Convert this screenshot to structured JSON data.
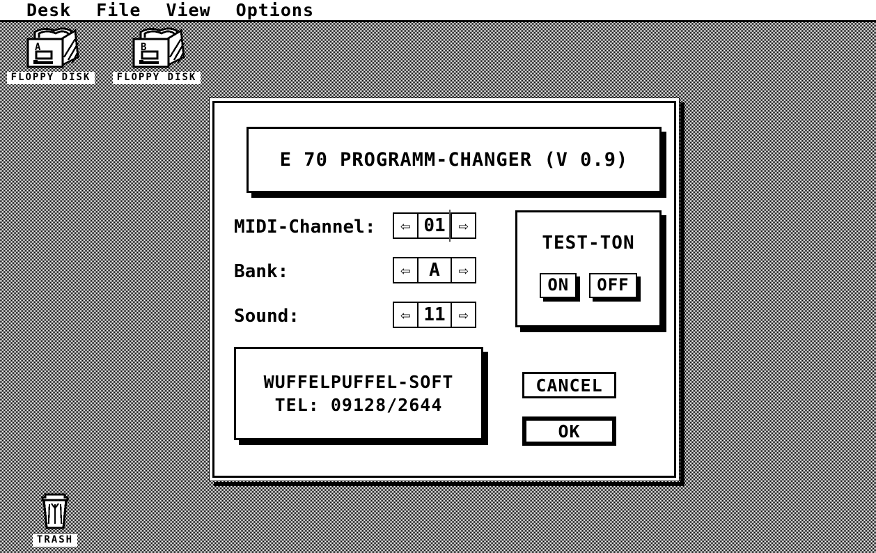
{
  "menubar": {
    "items": [
      {
        "label": "Desk",
        "name": "menu-desk"
      },
      {
        "label": "File",
        "name": "menu-file"
      },
      {
        "label": "View",
        "name": "menu-view"
      },
      {
        "label": "Options",
        "name": "menu-options"
      }
    ]
  },
  "desktop": {
    "icons": [
      {
        "label": "FLOPPY DISK",
        "drive": "A",
        "icon": "floppy-disk-icon"
      },
      {
        "label": "FLOPPY DISK",
        "drive": "B",
        "icon": "floppy-disk-icon"
      },
      {
        "label": "TRASH",
        "icon": "trash-icon"
      }
    ]
  },
  "dialog": {
    "title": "E 70 PROGRAMM-CHANGER (V 0.9)",
    "fields": [
      {
        "label": "MIDI-Channel:",
        "value": "01",
        "left_arrow": "⇦",
        "right_arrow": "⇨",
        "has_caret": true
      },
      {
        "label": "Bank:",
        "value": "A",
        "left_arrow": "⇦",
        "right_arrow": "⇨",
        "has_caret": false
      },
      {
        "label": "Sound:",
        "value": "11",
        "left_arrow": "⇦",
        "right_arrow": "⇨",
        "has_caret": false
      }
    ],
    "testtone": {
      "title": "TEST-TON",
      "on_label": "ON",
      "off_label": "OFF"
    },
    "vendor": {
      "name": "WUFFELPUFFEL-SOFT",
      "phone": "TEL: 09128/2644"
    },
    "buttons": {
      "cancel": "CANCEL",
      "ok": "OK"
    }
  },
  "colors": {
    "foreground": "#000000",
    "background": "#ffffff",
    "desktop_pattern": "#808080"
  }
}
